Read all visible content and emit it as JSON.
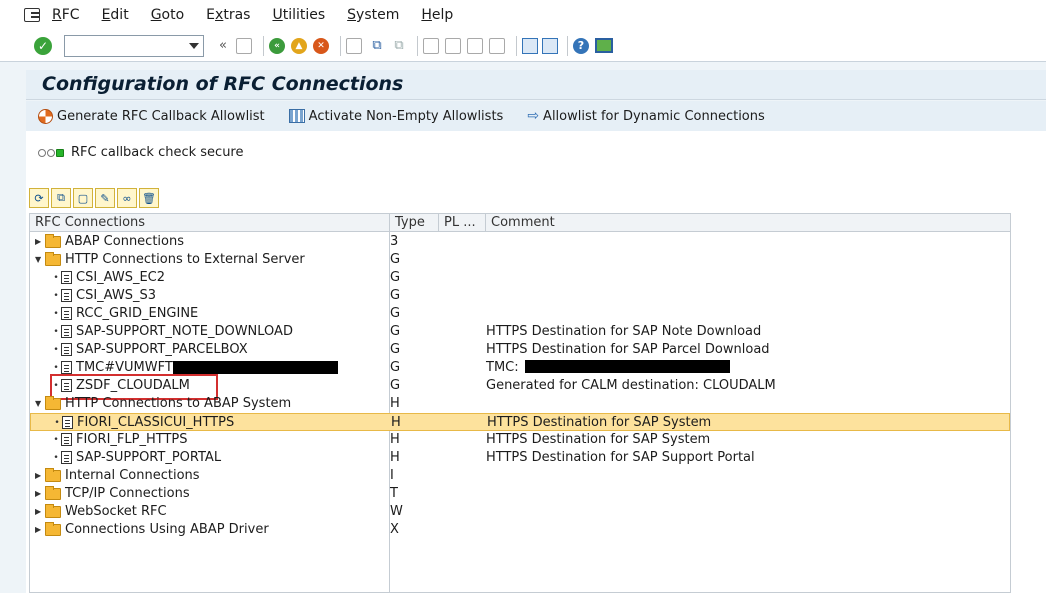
{
  "menu": [
    "RFC",
    "Edit",
    "Goto",
    "Extras",
    "Utilities",
    "System",
    "Help"
  ],
  "menu_underline": [
    "R",
    "E",
    "G",
    "x",
    "U",
    "S",
    "H"
  ],
  "toolbar": {
    "command_field_value": "",
    "nav_back_label": "«"
  },
  "title": "Configuration of RFC Connections",
  "app_toolbar": [
    {
      "label": "Generate RFC Callback Allowlist",
      "icon": "generate-icon"
    },
    {
      "label": "Activate Non-Empty Allowlists",
      "icon": "activate-icon"
    },
    {
      "label": "Allowlist for Dynamic Connections",
      "icon": "arrow-right-icon"
    }
  ],
  "status": {
    "text": "RFC callback check secure",
    "lights": [
      "off",
      "off",
      "green"
    ]
  },
  "tree_toolbar_icons": [
    "refresh-icon",
    "binoculars-icon",
    "create-icon",
    "change-icon",
    "copy-icon",
    "delete-icon"
  ],
  "columns": {
    "name": "RFC Connections",
    "type": "Type",
    "pl": "PL ...",
    "comment": "Comment"
  },
  "rows": [
    {
      "level": 0,
      "kind": "folder",
      "expanded": false,
      "name": "ABAP Connections",
      "type": "3",
      "comment": ""
    },
    {
      "level": 0,
      "kind": "folder",
      "expanded": true,
      "name": "HTTP Connections to External Server",
      "type": "G",
      "comment": ""
    },
    {
      "level": 1,
      "kind": "doc",
      "name": "CSI_AWS_EC2",
      "type": "G",
      "comment": ""
    },
    {
      "level": 1,
      "kind": "doc",
      "name": "CSI_AWS_S3",
      "type": "G",
      "comment": ""
    },
    {
      "level": 1,
      "kind": "doc",
      "name": "RCC_GRID_ENGINE",
      "type": "G",
      "comment": ""
    },
    {
      "level": 1,
      "kind": "doc",
      "name": "SAP-SUPPORT_NOTE_DOWNLOAD",
      "type": "G",
      "comment": "HTTPS Destination for SAP Note Download"
    },
    {
      "level": 1,
      "kind": "doc",
      "name": "SAP-SUPPORT_PARCELBOX",
      "type": "G",
      "comment": "HTTPS Destination for SAP Parcel Download"
    },
    {
      "level": 1,
      "kind": "doc",
      "name": "TMC#VUMWFT",
      "type": "G",
      "comment": "TMC:",
      "redacted": true
    },
    {
      "level": 1,
      "kind": "doc",
      "name": "ZSDF_CLOUDALM",
      "type": "G",
      "comment": "Generated for CALM destination: CLOUDALM",
      "boxed": true
    },
    {
      "level": 0,
      "kind": "folder",
      "expanded": true,
      "name": "HTTP Connections to ABAP System",
      "type": "H",
      "comment": ""
    },
    {
      "level": 1,
      "kind": "doc",
      "name": "FIORI_CLASSICUI_HTTPS",
      "type": "H",
      "comment": "HTTPS Destination for SAP System",
      "selected": true
    },
    {
      "level": 1,
      "kind": "doc",
      "name": "FIORI_FLP_HTTPS",
      "type": "H",
      "comment": "HTTPS Destination for SAP System"
    },
    {
      "level": 1,
      "kind": "doc",
      "name": "SAP-SUPPORT_PORTAL",
      "type": "H",
      "comment": "HTTPS Destination for SAP Support Portal"
    },
    {
      "level": 0,
      "kind": "folder",
      "expanded": false,
      "name": "Internal Connections",
      "type": "I",
      "comment": ""
    },
    {
      "level": 0,
      "kind": "folder",
      "expanded": false,
      "name": "TCP/IP Connections",
      "type": "T",
      "comment": ""
    },
    {
      "level": 0,
      "kind": "folder",
      "expanded": false,
      "name": "WebSocket RFC",
      "type": "W",
      "comment": ""
    },
    {
      "level": 0,
      "kind": "folder",
      "expanded": false,
      "name": "Connections Using ABAP Driver",
      "type": "X",
      "comment": ""
    }
  ],
  "colors": {
    "selected_row": "#fde29d",
    "highlight_box": "#d32f2f",
    "folder": "#f5b734"
  }
}
